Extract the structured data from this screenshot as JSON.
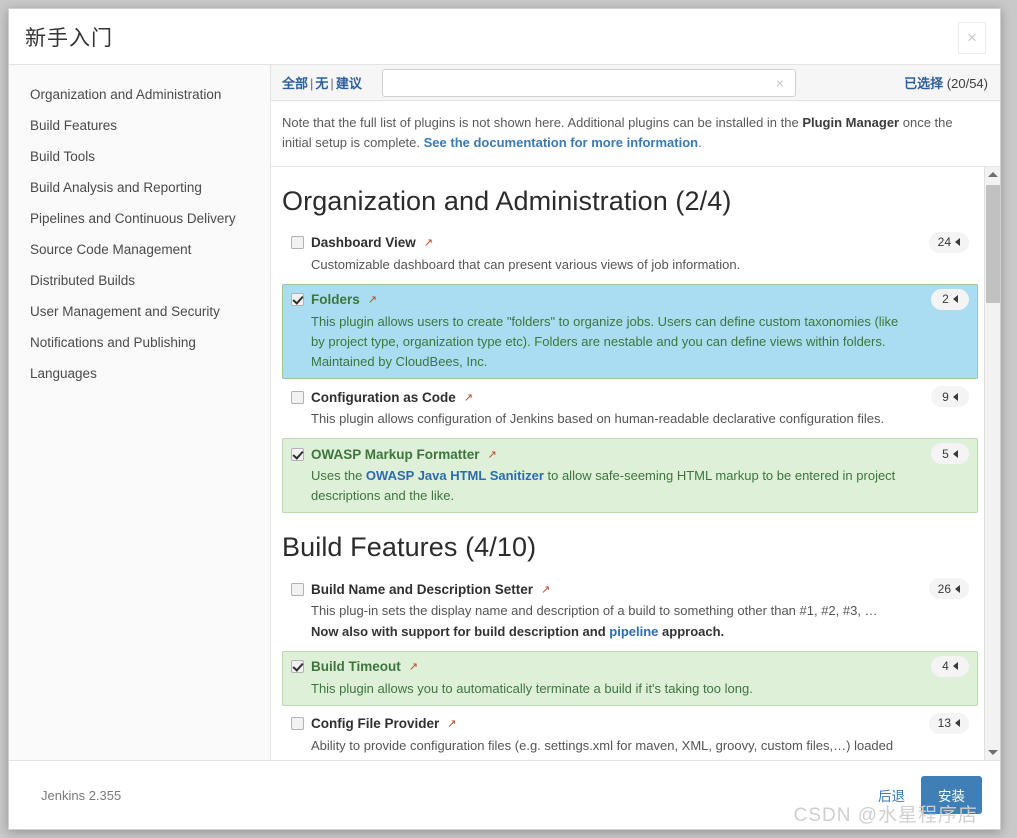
{
  "window": {
    "title": "新手入门",
    "close_label": "×"
  },
  "sidebar": {
    "items": [
      {
        "label": "Organization and Administration"
      },
      {
        "label": "Build Features"
      },
      {
        "label": "Build Tools"
      },
      {
        "label": "Build Analysis and Reporting"
      },
      {
        "label": "Pipelines and Continuous Delivery"
      },
      {
        "label": "Source Code Management"
      },
      {
        "label": "Distributed Builds"
      },
      {
        "label": "User Management and Security"
      },
      {
        "label": "Notifications and Publishing"
      },
      {
        "label": "Languages"
      }
    ]
  },
  "toolbar": {
    "filter_all": "全部",
    "filter_none": "无",
    "filter_suggested": "建议",
    "separator": "|",
    "search_value": "",
    "search_placeholder": "",
    "clear_icon": "×",
    "selected_label": "已选择",
    "selected_count": "(20/54)"
  },
  "notice": {
    "text_1": "Note that the full list of plugins is not shown here. Additional plugins can be installed in the ",
    "bold_1": "Plugin Manager",
    "text_2": " once the initial setup is complete. ",
    "link_1": "See the documentation for more information",
    "text_3": "."
  },
  "sections": [
    {
      "title": "Organization and Administration (2/4)",
      "plugins": [
        {
          "name": "Dashboard View",
          "ext_icon": "↗",
          "checked": false,
          "highlight": "none",
          "badge": "24",
          "desc_parts": [
            {
              "type": "text",
              "value": "Customizable dashboard that can present various views of job information."
            }
          ]
        },
        {
          "name": "Folders",
          "ext_icon": "↗",
          "checked": true,
          "highlight": "blue",
          "badge": "2",
          "desc_parts": [
            {
              "type": "text",
              "value": "This plugin allows users to create \"folders\" to organize jobs. Users can define custom taxonomies (like by project type, organization type etc). Folders are nestable and you can define views within folders. Maintained by CloudBees, Inc."
            }
          ]
        },
        {
          "name": "Configuration as Code",
          "ext_icon": "↗",
          "checked": false,
          "highlight": "none",
          "badge": "9",
          "desc_parts": [
            {
              "type": "text",
              "value": "This plugin allows configuration of Jenkins based on human-readable declarative configuration files."
            }
          ]
        },
        {
          "name": "OWASP Markup Formatter",
          "ext_icon": "↗",
          "checked": true,
          "highlight": "green",
          "badge": "5",
          "desc_parts": [
            {
              "type": "text",
              "value": "Uses the "
            },
            {
              "type": "link",
              "value": "OWASP Java HTML Sanitizer"
            },
            {
              "type": "text",
              "value": " to allow safe-seeming HTML markup to be entered in project descriptions and the like."
            }
          ]
        }
      ]
    },
    {
      "title": "Build Features (4/10)",
      "plugins": [
        {
          "name": "Build Name and Description Setter",
          "ext_icon": "↗",
          "checked": false,
          "highlight": "none",
          "badge": "26",
          "desc_parts": [
            {
              "type": "text",
              "value": "This plug-in sets the display name and description of a build to something other than #1, #2, #3, …"
            },
            {
              "type": "break",
              "value": ""
            },
            {
              "type": "bold",
              "value": "Now also with support for build description and "
            },
            {
              "type": "link",
              "value": "pipeline"
            },
            {
              "type": "bold",
              "value": " approach."
            }
          ]
        },
        {
          "name": "Build Timeout",
          "ext_icon": "↗",
          "checked": true,
          "highlight": "green",
          "badge": "4",
          "desc_parts": [
            {
              "type": "text",
              "value": "This plugin allows you to automatically terminate a build if it's taking too long."
            }
          ]
        },
        {
          "name": "Config File Provider",
          "ext_icon": "↗",
          "checked": false,
          "highlight": "none",
          "badge": "13",
          "desc_parts": [
            {
              "type": "text",
              "value": "Ability to provide configuration files (e.g. settings.xml for maven, XML, groovy, custom files,…) loaded through the"
            }
          ]
        }
      ]
    }
  ],
  "footer": {
    "version": "Jenkins 2.355",
    "back_label": "后退",
    "install_label": "安装",
    "watermark": "CSDN @水星程序店"
  }
}
